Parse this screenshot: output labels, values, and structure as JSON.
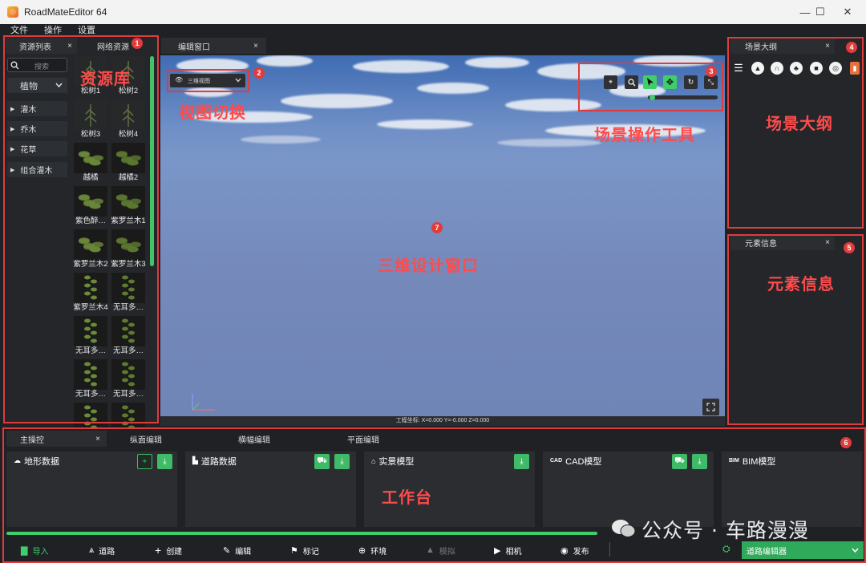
{
  "app": {
    "title": "RoadMateEditor 64"
  },
  "window": {
    "minimize": "—",
    "maximize": "☐",
    "close": "✕"
  },
  "menu": [
    "文件",
    "操作",
    "设置"
  ],
  "left": {
    "tabs": [
      {
        "label": "资源列表",
        "close": "×"
      },
      {
        "label": "网络资源"
      }
    ],
    "search_placeholder": "搜索",
    "category": "植物",
    "tree": [
      "灌木",
      "乔木",
      "花草",
      "组合灌木"
    ],
    "assets": [
      "松树1",
      "松树2",
      "松树3",
      "松树4",
      "越橘",
      "越橘2",
      "紫色醉…",
      "紫罗兰木1",
      "紫罗兰木2",
      "紫罗兰木3",
      "紫罗兰木4",
      "无耳多…",
      "无耳多…",
      "无耳多…",
      "无耳多…",
      "无耳多…",
      "",
      ""
    ]
  },
  "editor": {
    "tab": {
      "label": "编辑窗口",
      "close": "×"
    },
    "view_mode": "三维视图",
    "status": "工程坐标:  X=0.000 Y=-0.000 Z=0.000"
  },
  "outline": {
    "tab": {
      "label": "场景大纲",
      "close": "×"
    }
  },
  "element": {
    "tab": {
      "label": "元素信息",
      "close": "×"
    }
  },
  "bottom": {
    "tabs": [
      {
        "label": "主操控",
        "close": "×"
      },
      {
        "label": "纵面编辑"
      },
      {
        "label": "横幅编辑"
      },
      {
        "label": "平面编辑"
      }
    ],
    "cards": [
      {
        "title": "地形数据",
        "icon": "terrain-icon"
      },
      {
        "title": "道路数据",
        "icon": "road-icon"
      },
      {
        "title": "实景模型",
        "icon": "house-icon"
      },
      {
        "title": "CAD模型",
        "icon": "cad-icon"
      },
      {
        "title": "BIM模型",
        "icon": "bim-icon"
      }
    ],
    "toolbar": [
      "导入",
      "道路",
      "创建",
      "编辑",
      "标记",
      "环境",
      "模拟",
      "相机",
      "发布"
    ],
    "editor_select": "道路编辑器"
  },
  "annotations": {
    "badges": [
      "1",
      "2",
      "3",
      "4",
      "5",
      "6",
      "7"
    ],
    "labels": {
      "library": "资源库",
      "view_switch": "视图切换",
      "scene_tools": "场景操作工具",
      "scene_outline": "场景大纲",
      "element_info": "元素信息",
      "design_window": "三维设计窗口",
      "workbench": "工作台"
    }
  },
  "watermark": "公众号 · 车路漫漫",
  "colors": {
    "accent": "#3fce6a",
    "annotation": "#e03c3c",
    "panel": "#2b2d31",
    "background": "#1f2124"
  }
}
